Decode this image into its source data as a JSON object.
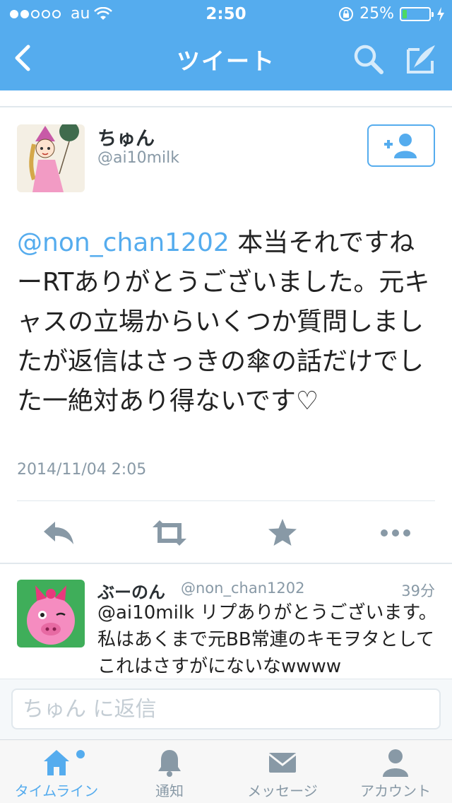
{
  "status_bar": {
    "carrier": "au",
    "time": "2:50",
    "battery_percent": "25%",
    "battery_level": 0.25,
    "signal_bars_filled": 2,
    "signal_bars_total": 5
  },
  "nav": {
    "title": "ツイート",
    "icons": [
      "back-chevron-icon",
      "search-icon",
      "compose-tweet-icon"
    ]
  },
  "tweet": {
    "display_name": "ちゅん",
    "screen_name": "@ai10milk",
    "mention": "@non_chan1202",
    "text": " 本当それですねーRTありがとうございました。元キャスの立場からいくつか質問しましたが返信はさっきの傘の話だけでした一絶対あり得ないです♡",
    "timestamp": "2014/11/04 2:05",
    "follow_icon": "add-user-icon"
  },
  "actions": [
    "reply-icon",
    "retweet-icon",
    "favorite-star-icon",
    "more-icon"
  ],
  "reply": {
    "display_name": "ぶーのん",
    "screen_name": "@non_chan1202",
    "time_ago": "39分",
    "mention": "@ai10milk",
    "text": " リプありがとうございます。私はあくまで元BB常連のキモヲタとしてこれはさすがにないなwwww"
  },
  "reply_input": {
    "placeholder": "ちゅん に返信"
  },
  "tabbar": {
    "tabs": [
      {
        "label": "タイムライン",
        "icon": "home-icon",
        "active": true
      },
      {
        "label": "通知",
        "icon": "bell-icon",
        "active": false
      },
      {
        "label": "メッセージ",
        "icon": "envelope-icon",
        "active": false
      },
      {
        "label": "アカウント",
        "icon": "person-icon",
        "active": false
      }
    ]
  },
  "colors": {
    "brand": "#55acee",
    "text": "#222222",
    "muted": "#8899a6",
    "battery": "#4cd964"
  }
}
